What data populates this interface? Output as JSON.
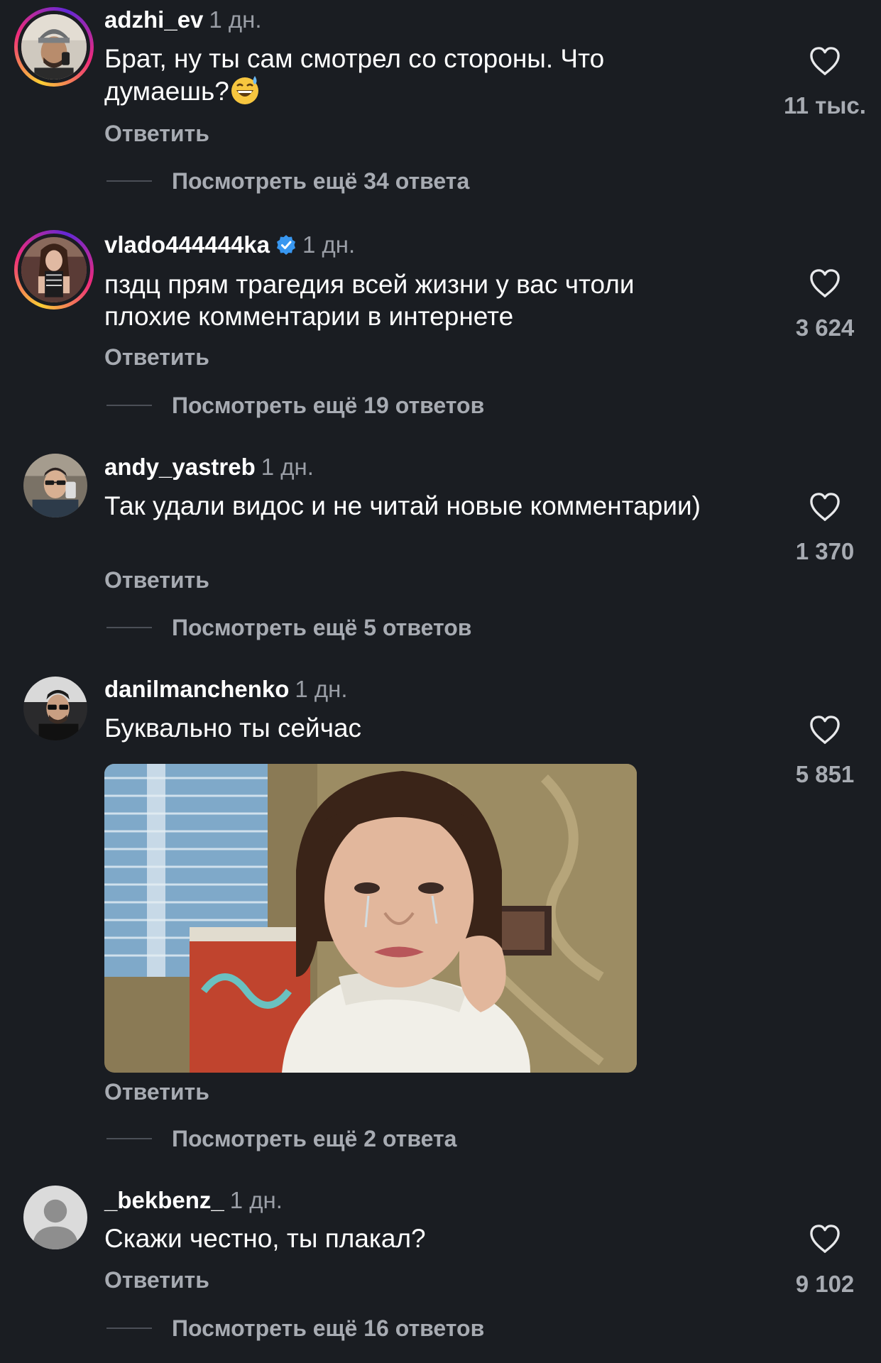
{
  "comments": [
    {
      "username": "adzhi_ev",
      "time": "1 дн.",
      "text": "Брат, ну ты сам смотрел со стороны. Что думаешь?",
      "emoji": "grinning-sweat-emoji",
      "reply_label": "Ответить",
      "view_more": "Посмотреть ещё 34 ответа",
      "likes": "11 тыс."
    },
    {
      "username": "vlado444444ka",
      "verified": true,
      "time": "1 дн.",
      "text": "пздц прям трагедия всей жизни у вас чтоли плохие комментарии в интернете",
      "reply_label": "Ответить",
      "view_more": "Посмотреть ещё 19 ответов",
      "likes": "3 624"
    },
    {
      "username": "andy_yastreb",
      "time": "1 дн.",
      "text": "Так удали видос и не читай новые комментарии)",
      "reply_label": "Ответить",
      "view_more": "Посмотреть ещё 5 ответов",
      "likes": "1 370"
    },
    {
      "username": "danilmanchenko",
      "time": "1 дн.",
      "text": "Буквально ты сейчас",
      "has_image": true,
      "reply_label": "Ответить",
      "view_more": "Посмотреть ещё 2 ответа",
      "likes": "5 851"
    },
    {
      "username": "_bekbenz_",
      "time": "1 дн.",
      "text": "Скажи честно, ты плакал?",
      "reply_label": "Ответить",
      "view_more": "Посмотреть ещё 16 ответов",
      "likes": "9 102"
    }
  ],
  "icons": {
    "like": "heart-outline-icon",
    "verified": "verified-badge-icon",
    "default_avatar": "person-silhouette-icon"
  },
  "colors": {
    "background": "#1a1d22",
    "primary_text": "#ffffff",
    "secondary_text": "#a7abb2",
    "time_text": "#9a9ea6",
    "verified": "#3897f0"
  }
}
